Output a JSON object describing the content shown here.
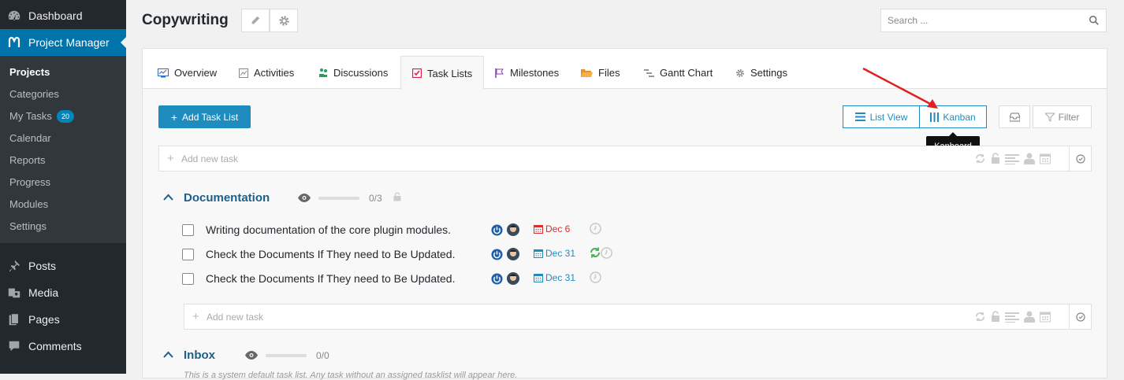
{
  "sidebar": {
    "top_items": [
      {
        "label": "Dashboard",
        "icon": "dashboard-icon"
      },
      {
        "label": "Project Manager",
        "icon": "project-manager-icon",
        "active": true
      }
    ],
    "submenu": [
      {
        "label": "Projects",
        "current": true
      },
      {
        "label": "Categories"
      },
      {
        "label": "My Tasks",
        "badge": "20"
      },
      {
        "label": "Calendar"
      },
      {
        "label": "Reports"
      },
      {
        "label": "Progress"
      },
      {
        "label": "Modules"
      },
      {
        "label": "Settings"
      }
    ],
    "bottom_items": [
      {
        "label": "Posts",
        "icon": "pin-icon"
      },
      {
        "label": "Media",
        "icon": "media-icon"
      },
      {
        "label": "Pages",
        "icon": "pages-icon"
      },
      {
        "label": "Comments",
        "icon": "comments-icon"
      }
    ]
  },
  "header": {
    "title": "Copywriting",
    "search_placeholder": "Search ..."
  },
  "tabs": [
    {
      "label": "Overview",
      "icon": "overview-icon"
    },
    {
      "label": "Activities",
      "icon": "activities-icon"
    },
    {
      "label": "Discussions",
      "icon": "discussions-icon"
    },
    {
      "label": "Task Lists",
      "icon": "task-lists-icon",
      "active": true
    },
    {
      "label": "Milestones",
      "icon": "milestones-icon"
    },
    {
      "label": "Files",
      "icon": "folder-icon"
    },
    {
      "label": "Gantt Chart",
      "icon": "gantt-icon"
    },
    {
      "label": "Settings",
      "icon": "gear-icon"
    }
  ],
  "toolbar": {
    "add_task_list": "Add Task List",
    "list_view": "List View",
    "kanban": "Kanban",
    "filter": "Filter",
    "tooltip": "Kanboard"
  },
  "add_task_placeholder": "Add new task",
  "lists": [
    {
      "title": "Documentation",
      "count": "0/3",
      "progress": 0,
      "tasks": [
        {
          "title": "Writing documentation of the core plugin modules.",
          "due": "Dec 6",
          "overdue": true,
          "repeat": false
        },
        {
          "title": "Check the Documents If They need to Be Updated.",
          "due": "Dec 31",
          "overdue": false,
          "repeat": true
        },
        {
          "title": "Check the Documents If They need to Be Updated.",
          "due": "Dec 31",
          "overdue": false,
          "repeat": false
        }
      ]
    },
    {
      "title": "Inbox",
      "count": "0/0",
      "progress": 0,
      "description": "This is a system default task list. Any task without an assigned tasklist will appear here."
    }
  ],
  "colors": {
    "accent": "#1e8cbe",
    "wp_sidebar": "#23282d",
    "wp_active": "#0073aa",
    "overdue": "#d9302f",
    "repeat": "#46b450",
    "annotation_arrow": "#e02020"
  }
}
